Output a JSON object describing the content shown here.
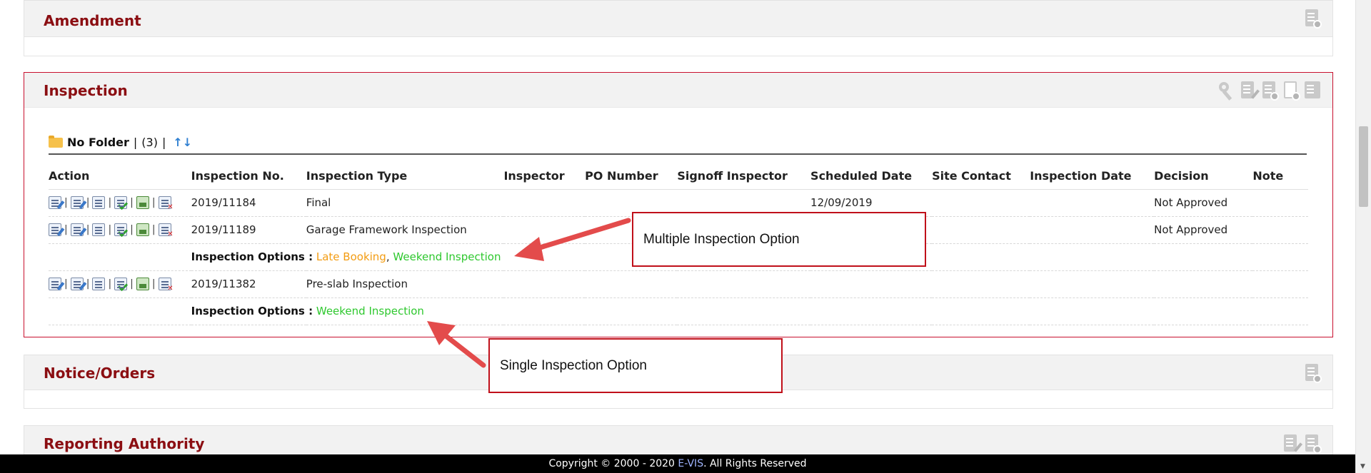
{
  "sections": {
    "amendment": {
      "title": "Amendment"
    },
    "inspection": {
      "title": "Inspection"
    },
    "notice": {
      "title": "Notice/Orders"
    },
    "reporting": {
      "title": "Reporting Authority"
    }
  },
  "folder": {
    "name": "No Folder",
    "separator": "|",
    "count": "(3)",
    "separator2": "|",
    "sort_icon": "↑↓"
  },
  "table": {
    "headers": [
      "Action",
      "Inspection No.",
      "Inspection Type",
      "Inspector",
      "PO Number",
      "Signoff Inspector",
      "Scheduled Date",
      "Site Contact",
      "Inspection Date",
      "Decision",
      "Note"
    ],
    "rows": [
      {
        "no": "2019/11184",
        "type": "Final",
        "inspector": "",
        "po": "",
        "signoff": "",
        "scheduled": "12/09/2019",
        "site_contact": "",
        "inspection_date": "",
        "decision": "Not Approved",
        "note": ""
      },
      {
        "no": "2019/11189",
        "type": "Garage Framework Inspection",
        "inspector": "",
        "po": "",
        "signoff": "",
        "scheduled": "",
        "site_contact": "",
        "inspection_date": "",
        "decision": "Not Approved",
        "note": ""
      },
      {
        "no": "2019/11382",
        "type": "Pre-slab Inspection",
        "inspector": "",
        "po": "",
        "signoff": "",
        "scheduled": "",
        "site_contact": "",
        "inspection_date": "",
        "decision": "",
        "note": ""
      }
    ],
    "options_label": "Inspection Options :",
    "options_row2": {
      "opt1": "Late Booking",
      "sep": ",",
      "opt2": "Weekend Inspection"
    },
    "options_row3": {
      "opt1": "Weekend Inspection"
    }
  },
  "callouts": {
    "multiple": "Multiple Inspection Option",
    "single": "Single Inspection Option"
  },
  "footer": {
    "prefix": "Copyright © 2000 - 2020 ",
    "brand": "E-VIS",
    "suffix": ". All Rights Reserved"
  },
  "colors": {
    "section_title": "#8b0e12",
    "link_red": "#e02424",
    "option_orange": "#f39c12",
    "option_green": "#2ec82e",
    "callout_border": "#c0101a",
    "arrow": "#e34b4b"
  },
  "icons": {
    "header_actions": [
      "key-icon",
      "edit-doc-icon",
      "add-doc-icon",
      "add-sheet-icon",
      "folder-doc-icon"
    ],
    "row_actions": [
      "edit-icon",
      "inspect-icon",
      "list-icon",
      "approve-icon",
      "image-icon",
      "delete-icon"
    ]
  }
}
